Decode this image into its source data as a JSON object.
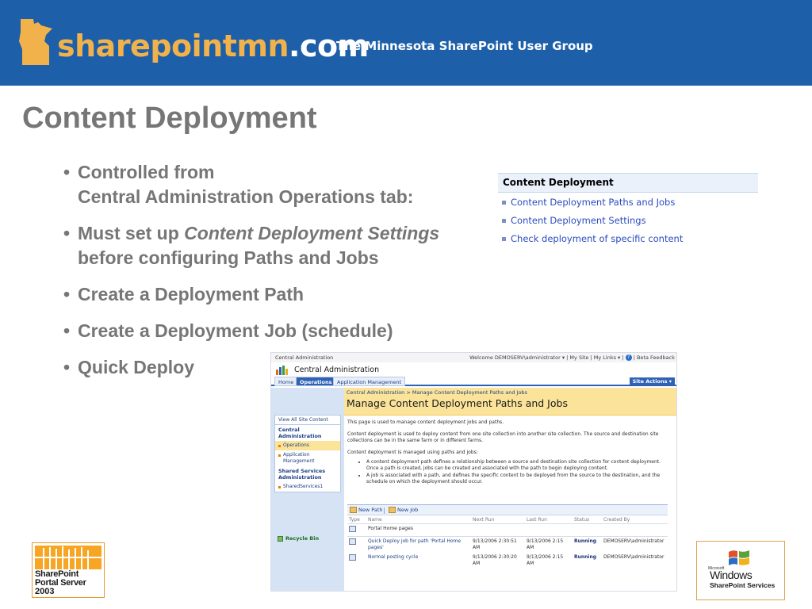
{
  "banner": {
    "brand_main": "sharepointmn",
    "brand_tld": ".com",
    "tagline": "The Minnesota SharePoint User Group",
    "logo_icon": "minnesota-state-icon",
    "logo_color": "#f2b24b",
    "background_color": "#1d5fa8"
  },
  "slide": {
    "title": "Content Deployment",
    "bullet_char": "•",
    "bullets": [
      {
        "line1": "Controlled from",
        "line2": "Central Administration Operations tab:"
      },
      {
        "prefix": "Must set up ",
        "emphasis": "Content Deployment Settings",
        "line2": "before configuring Paths and Jobs"
      },
      {
        "text": "Create a Deployment Path"
      },
      {
        "text": "Create a Deployment Job (schedule)"
      },
      {
        "text": "Quick Deploy"
      }
    ]
  },
  "mini_panel": {
    "heading": "Content Deployment",
    "links": [
      "Content Deployment Paths and Jobs",
      "Content Deployment Settings",
      "Check deployment of specific content"
    ]
  },
  "screenshot": {
    "topbar": {
      "left": "Central Administration",
      "welcome": "Welcome DEMOSERV\\administrator ▾",
      "my_site": "My Site",
      "my_links": "My Links ▾",
      "help_icon": "?",
      "beta_feedback": "Beta Feedback"
    },
    "site_title": "Central Administration",
    "tabs": [
      "Home",
      "Operations",
      "Application Management"
    ],
    "selected_tab": "Operations",
    "site_actions": "Site Actions ▾",
    "breadcrumb": "Central Administration > Manage Content Deployment Paths and Jobs",
    "page_title": "Manage Content Deployment Paths and Jobs",
    "nav": {
      "view_all": "View All Site Content",
      "section1": "Central Administration",
      "items1": [
        "Operations",
        "Application Management"
      ],
      "section2": "Shared Services Administration",
      "items2": [
        "SharedServices1"
      ],
      "recycle": "Recycle Bin"
    },
    "description": [
      "This page is used to manage content deployment jobs and paths.",
      "Content deployment is used to deploy content from one site collection into another site collection. The source and destination site collections can be in the same farm or in different farms.",
      "Content deployment is managed using paths and jobs:"
    ],
    "description_bullets": [
      "A content deployment path defines a relationship between a source and destination site collection for content deployment. Once a path is created, jobs can be created and associated with the path to begin deploying content.",
      "A job is associated with a path, and defines the specific content to be deployed from the source to the destination, and the schedule on which the deployment should occur."
    ],
    "toolbar": {
      "new_path": "New Path",
      "new_job": "New Job"
    },
    "columns": [
      "Type",
      "Name",
      "Next Run",
      "Last Run",
      "Status",
      "Created By"
    ],
    "group": "Portal Home pages",
    "rows": [
      {
        "name": "Quick Deploy job for path 'Portal Home pages'",
        "next_run": "9/13/2006 2:30:51 AM",
        "last_run": "9/13/2006 2:15 AM",
        "status": "Running",
        "created_by": "DEMOSERV\\administrator"
      },
      {
        "name": "Normal posting cycle",
        "next_run": "9/13/2006 2:30:20 AM",
        "last_run": "9/13/2006 2:15 AM",
        "status": "Running",
        "created_by": "DEMOSERV\\administrator"
      }
    ]
  },
  "logos": {
    "sps": {
      "line1": "SharePoint",
      "line2": "Portal Server",
      "line3": "2003"
    },
    "wss": {
      "microsoft": "Microsoft",
      "windows": "Windows",
      "services": "SharePoint Services"
    }
  }
}
